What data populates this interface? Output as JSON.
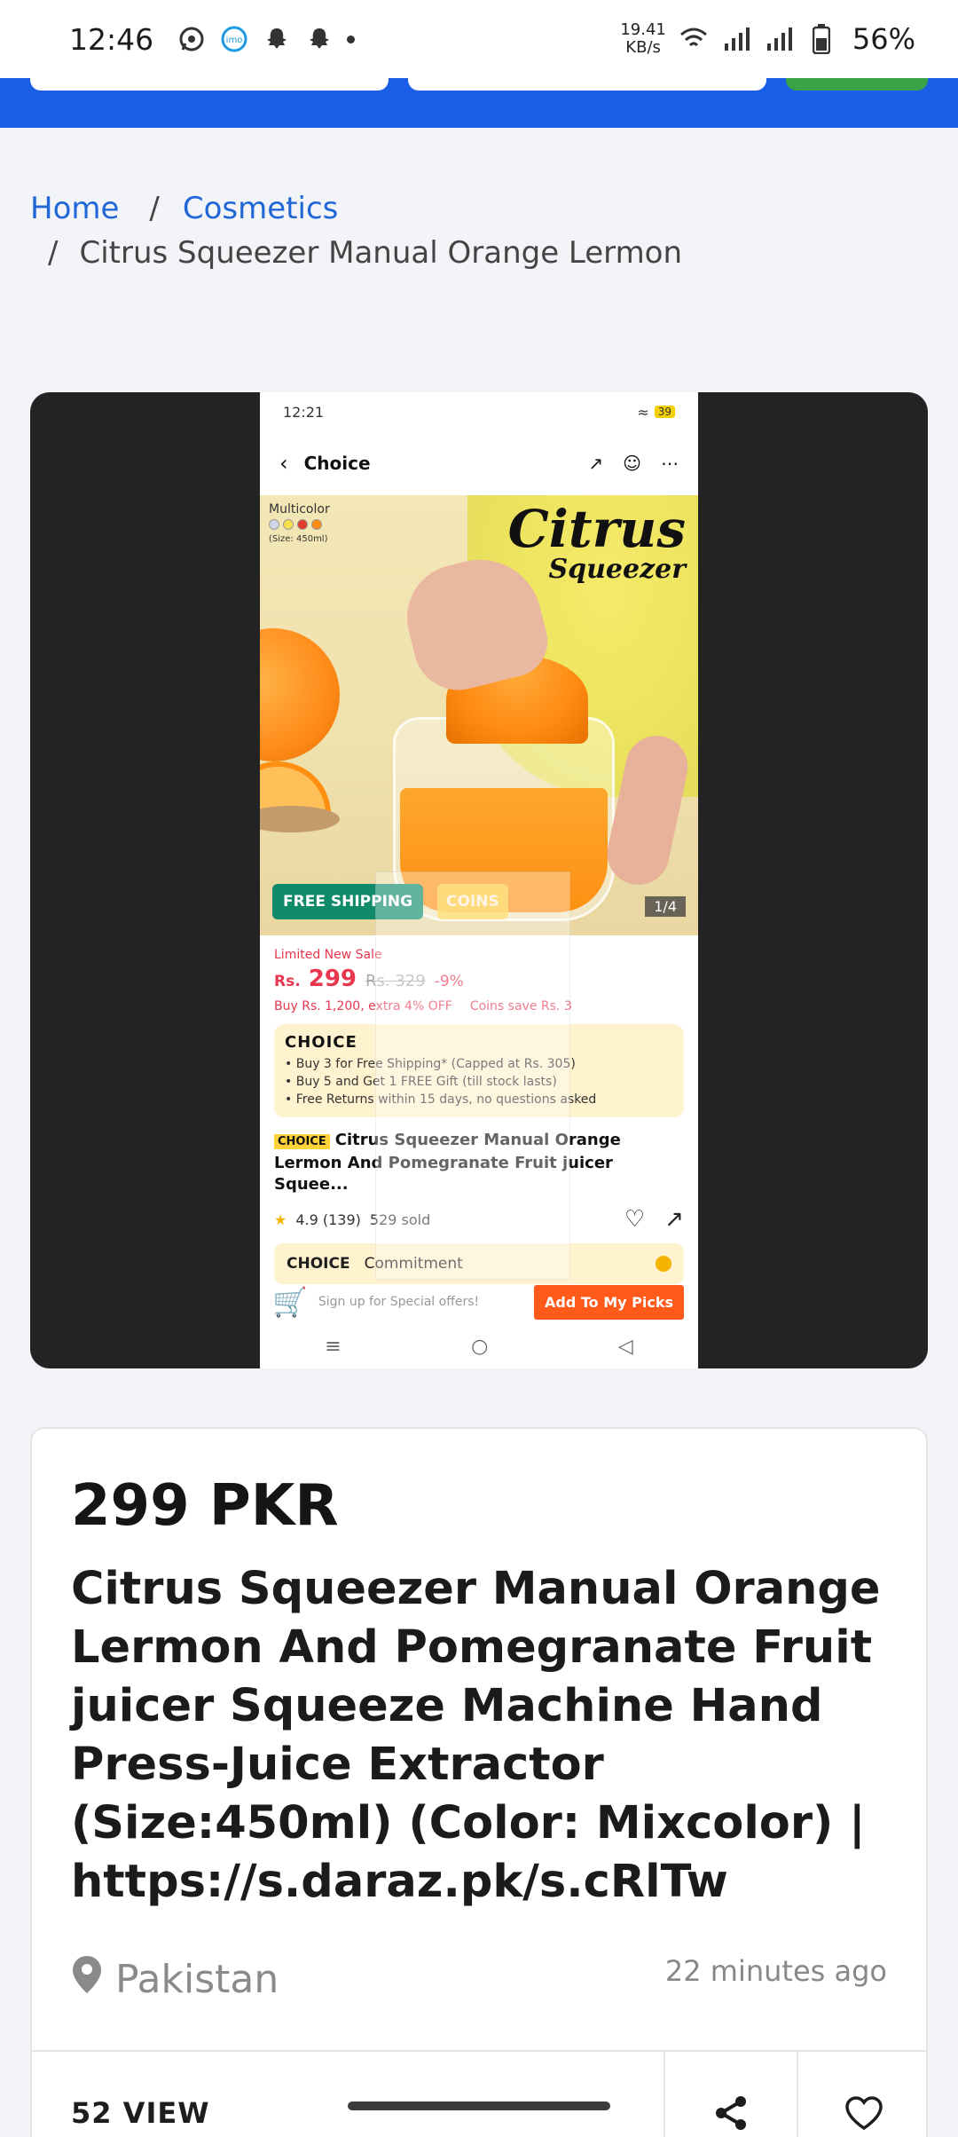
{
  "status_bar": {
    "time": "12:46",
    "speed_top": "19.41",
    "speed_bottom": "KB/s",
    "battery": "56%",
    "icons": [
      "whatsapp-icon",
      "imo-icon",
      "snapchat-icon",
      "snapchat-icon",
      "dot-icon",
      "wifi-icon",
      "signal-icon",
      "signal-icon",
      "battery-icon"
    ]
  },
  "breadcrumb": {
    "home": "Home",
    "category": "Cosmetics",
    "separator": "/",
    "current": "Citrus Squeezer Manual Orange Lermon"
  },
  "viewer": {
    "phone_status_time": "12:21",
    "phone_battery": "39",
    "nav_title": "Choice",
    "variant_label": "Multicolor",
    "variant_size": "(Size: 450ml)",
    "brand_line1": "Citrus",
    "brand_line2": "Squeezer",
    "free_shipping": "FREE SHIPPING",
    "coins": "COINS",
    "image_counter": "1/4",
    "limited_sale": "Limited New Sale",
    "price_currency": "Rs.",
    "price": "299",
    "old_price": "Rs. 329",
    "discount": "-9%",
    "buy_offer": "Buy Rs. 1,200, extra 4% OFF",
    "coins_save": "Coins save Rs. 3",
    "choice_logo": "CHOICE",
    "choice_points": [
      "Buy 3 for Free Shipping* (Capped at Rs. 305)",
      "Buy 5 and Get 1 FREE Gift (till stock lasts)",
      "Free Returns within 15 days, no questions asked"
    ],
    "tag_choice": "CHOICE",
    "product_title": "Citrus Squeezer Manual Orange Lermon And Pomegranate Fruit juicer Squee...",
    "rating": "4.9 (139)",
    "sold": "529 sold",
    "commitment_logo": "CHOICE",
    "commitment": "Commitment",
    "signup": "Sign up for Special offers!",
    "add_button": "Add To My Picks"
  },
  "listing": {
    "price": "299 PKR",
    "title": "Citrus Squeezer Manual Orange Lermon And Pomegranate Fruit juicer Squeeze Machine Hand Press-Juice Extractor (Size:450ml) (Color: Mixcolor) | https://s.daraz.pk/s.cRlTw",
    "location": "Pakistan",
    "posted": "22 minutes ago",
    "views": "52 VIEW"
  },
  "colors": {
    "brand_blue": "#1a5de6",
    "link_blue": "#1f66d6",
    "sale_red": "#e8374f",
    "action_orange": "#ff5a1a"
  }
}
